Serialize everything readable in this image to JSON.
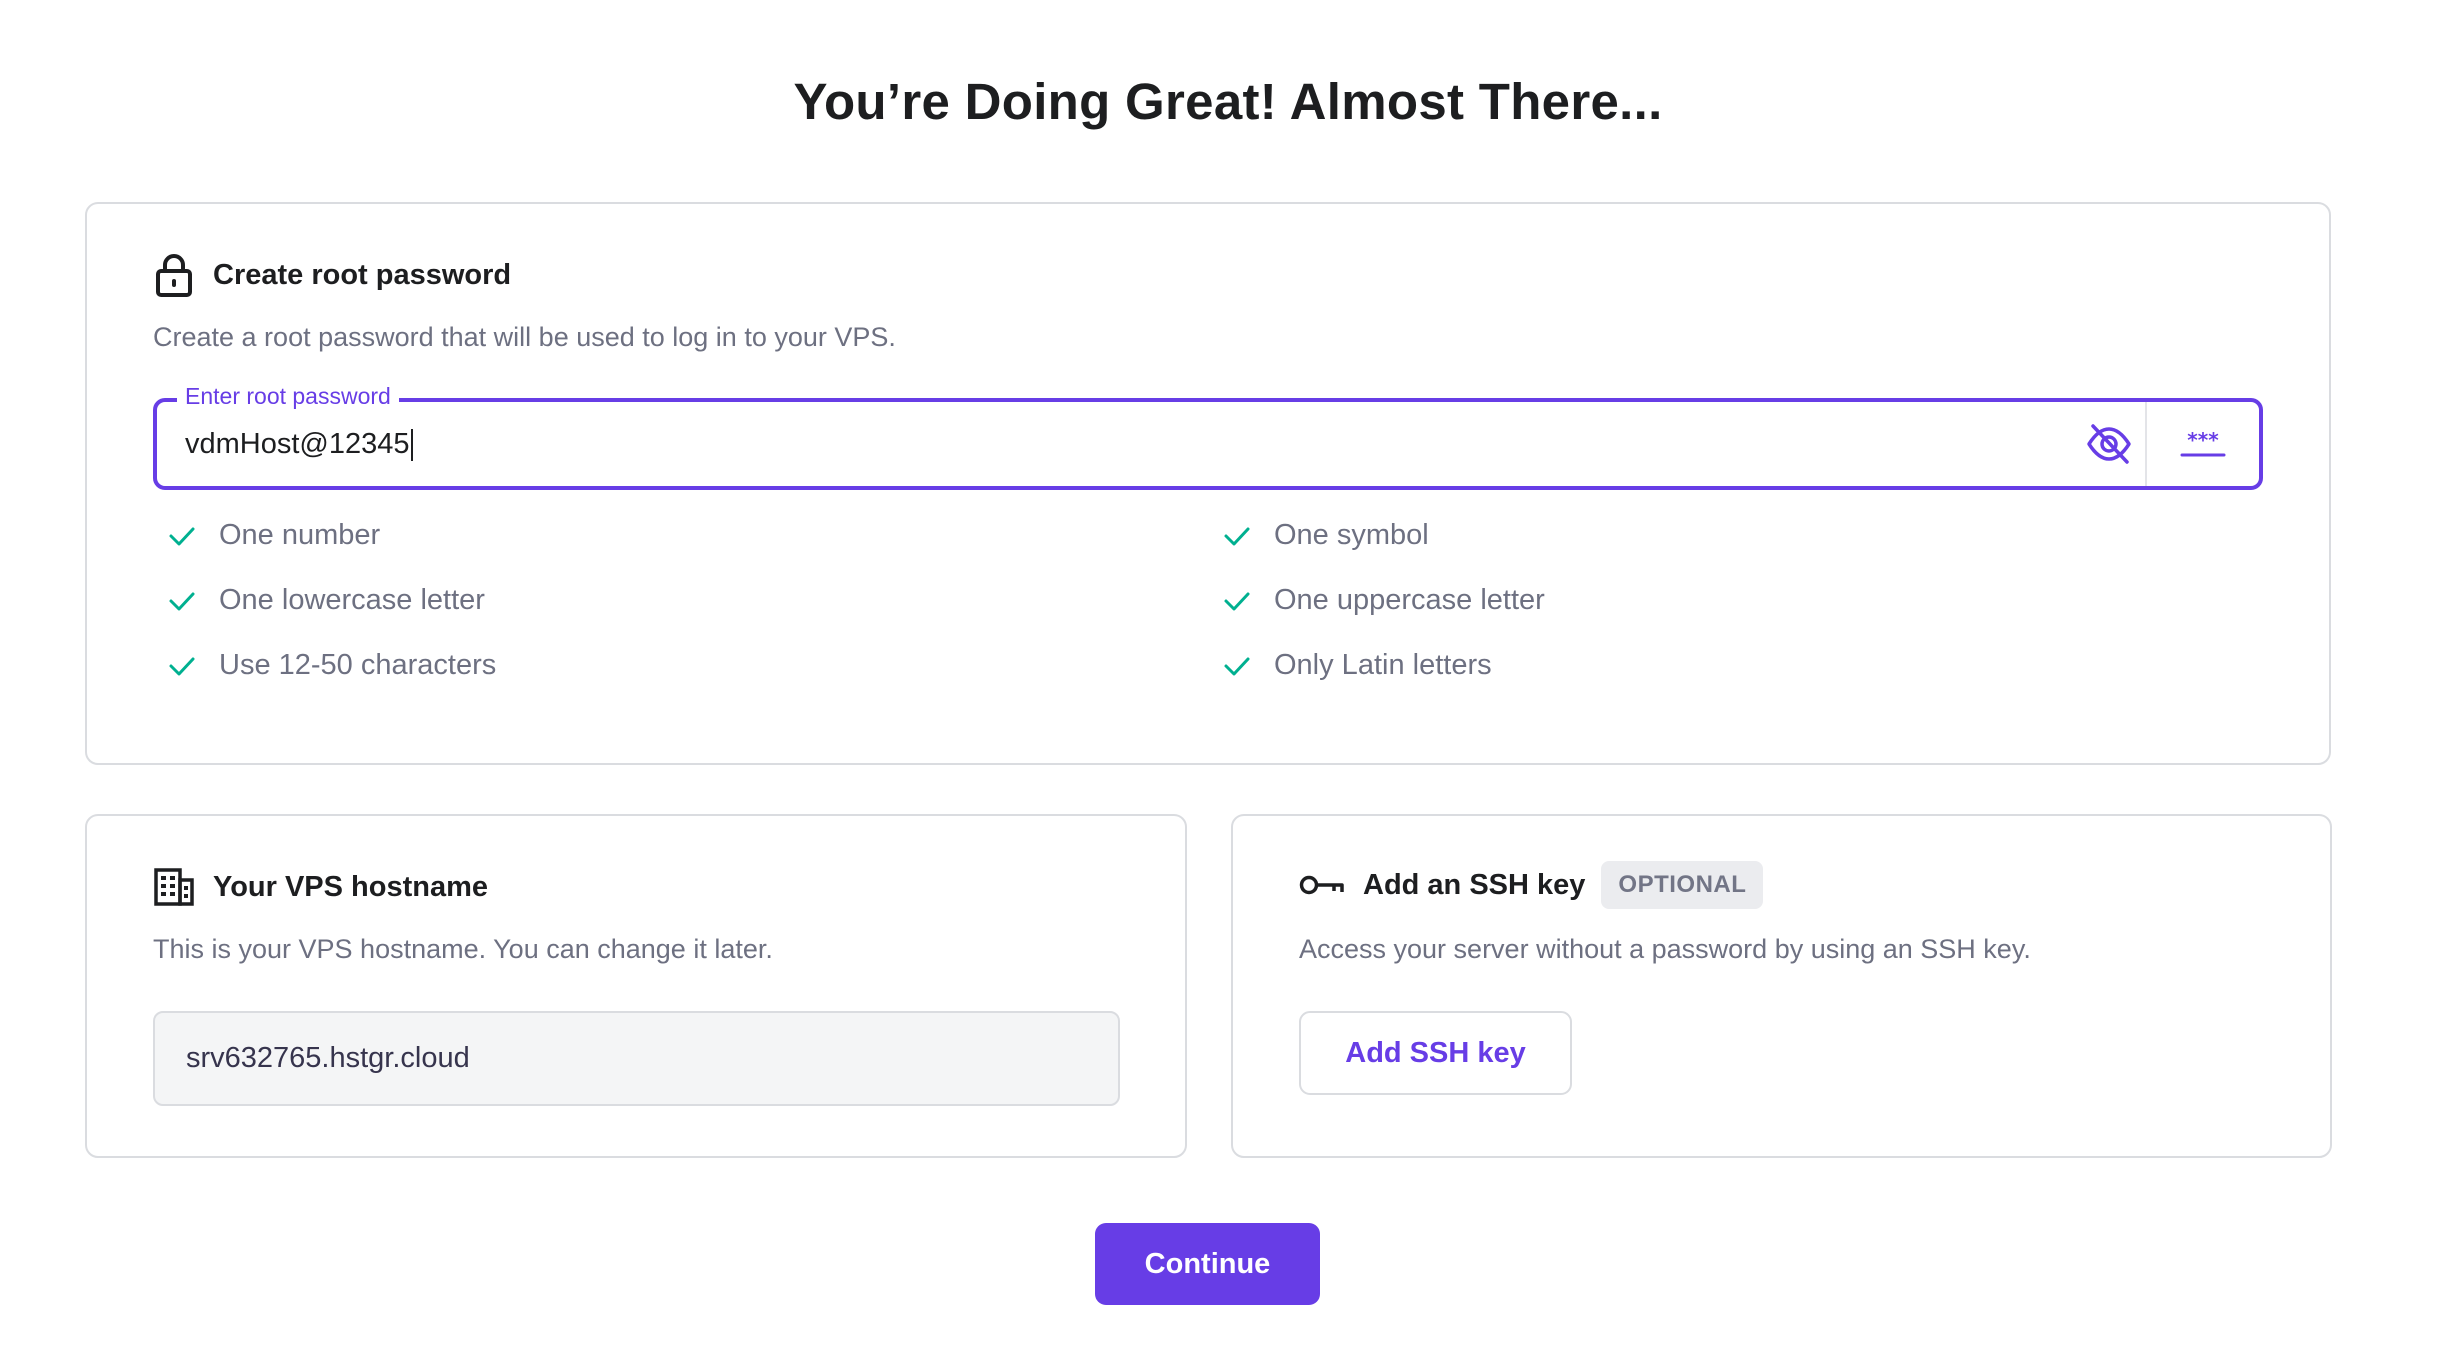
{
  "page": {
    "title": "You’re Doing Great! Almost There..."
  },
  "password_card": {
    "title": "Create root password",
    "icon": "lock-icon",
    "description": "Create a root password that will be used to log in to your VPS.",
    "field_label": "Enter root password",
    "field_value": "vdmHost@12345",
    "toggle_icon": "eye-slash-icon",
    "generate_icon": "asterisks-icon",
    "rules": [
      {
        "label": "One number",
        "met": true
      },
      {
        "label": "One lowercase letter",
        "met": true
      },
      {
        "label": "Use 12-50 characters",
        "met": true
      },
      {
        "label": "One symbol",
        "met": true
      },
      {
        "label": "One uppercase letter",
        "met": true
      },
      {
        "label": "Only Latin letters",
        "met": true
      }
    ]
  },
  "hostname_card": {
    "title": "Your VPS hostname",
    "icon": "building-icon",
    "description": "This is your VPS hostname. You can change it later.",
    "value": "srv632765.hstgr.cloud"
  },
  "ssh_card": {
    "title": "Add an SSH key",
    "icon": "key-icon",
    "badge": "OPTIONAL",
    "description": "Access your server without a password by using an SSH key.",
    "button_label": "Add SSH key"
  },
  "continue_label": "Continue",
  "colors": {
    "accent": "#673de6",
    "success": "#00b090",
    "text": "#1d1e20",
    "muted": "#6d7081",
    "border": "#dadce0"
  }
}
